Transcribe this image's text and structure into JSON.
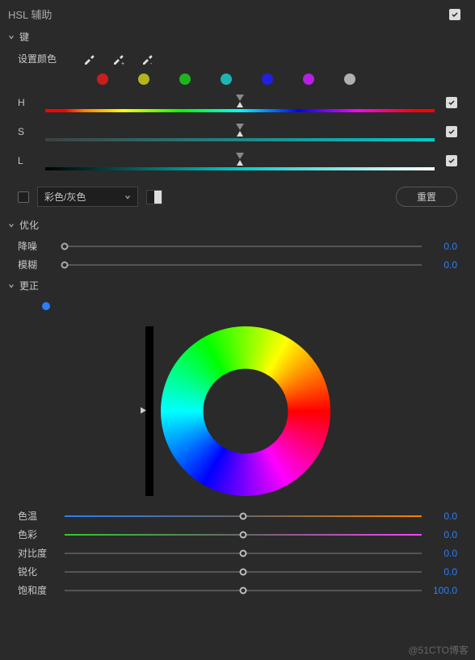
{
  "panel": {
    "title": "HSL 辅助",
    "enabled": true
  },
  "sections": {
    "key": {
      "title": "键",
      "setColorLabel": "设置颜色",
      "swatches": [
        "#c81e1e",
        "#b4b41e",
        "#1eb41e",
        "#1eb4b4",
        "#2020e0",
        "#b420e0",
        "#b0b0b0"
      ]
    },
    "sliders": {
      "hLabel": "H",
      "sLabel": "S",
      "lLabel": "L",
      "hChecked": true,
      "sChecked": true,
      "lChecked": true
    },
    "colorMode": {
      "checked": false,
      "label": "彩色/灰色",
      "resetLabel": "重置"
    },
    "optimize": {
      "title": "优化",
      "denoise": {
        "label": "降噪",
        "value": "0.0",
        "pos": 0
      },
      "blur": {
        "label": "模糊",
        "value": "0.0",
        "pos": 0
      }
    },
    "correct": {
      "title": "更正",
      "sliders": {
        "temp": {
          "label": "色温",
          "value": "0.0",
          "pos": 50
        },
        "tint": {
          "label": "色彩",
          "value": "0.0",
          "pos": 50
        },
        "contrast": {
          "label": "对比度",
          "value": "0.0",
          "pos": 50
        },
        "sharpen": {
          "label": "锐化",
          "value": "0.0",
          "pos": 50
        },
        "saturation": {
          "label": "饱和度",
          "value": "100.0",
          "pos": 50
        }
      }
    }
  },
  "watermark": "@51CTO博客"
}
